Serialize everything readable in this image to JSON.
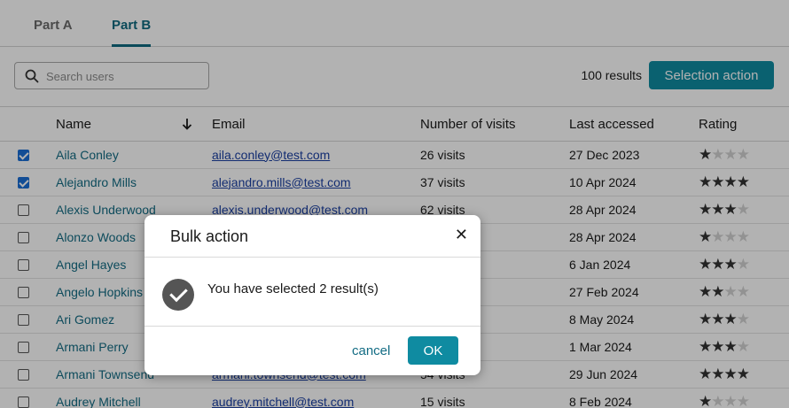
{
  "tabs": [
    {
      "label": "Part A",
      "active": false
    },
    {
      "label": "Part B",
      "active": true
    }
  ],
  "search": {
    "placeholder": "Search users",
    "value": ""
  },
  "results_count": "100 results",
  "selection_action_label": "Selection action",
  "table": {
    "columns": {
      "name": "Name",
      "email": "Email",
      "visits": "Number of visits",
      "last_accessed": "Last accessed",
      "rating": "Rating"
    },
    "sort_icon": "arrow-down-icon",
    "rows": [
      {
        "checked": true,
        "name": "Aila Conley",
        "email": "aila.conley@test.com",
        "visits": "26 visits",
        "last": "27 Dec 2023",
        "rating": 1
      },
      {
        "checked": true,
        "name": "Alejandro Mills",
        "email": "alejandro.mills@test.com",
        "visits": "37 visits",
        "last": "10 Apr 2024",
        "rating": 4
      },
      {
        "checked": false,
        "name": "Alexis Underwood",
        "email": "alexis.underwood@test.com",
        "visits": "62 visits",
        "last": "28 Apr 2024",
        "rating": 3
      },
      {
        "checked": false,
        "name": "Alonzo Woods",
        "email": "",
        "visits": "",
        "last": "28 Apr 2024",
        "rating": 1
      },
      {
        "checked": false,
        "name": "Angel Hayes",
        "email": "",
        "visits": "",
        "last": "6 Jan 2024",
        "rating": 3
      },
      {
        "checked": false,
        "name": "Angelo Hopkins",
        "email": "",
        "visits": "",
        "last": "27 Feb 2024",
        "rating": 2
      },
      {
        "checked": false,
        "name": "Ari Gomez",
        "email": "",
        "visits": "",
        "last": "8 May 2024",
        "rating": 3
      },
      {
        "checked": false,
        "name": "Armani Perry",
        "email": "",
        "visits": "",
        "last": "1 Mar 2024",
        "rating": 3
      },
      {
        "checked": false,
        "name": "Armani Townsend",
        "email": "armani.townsend@test.com",
        "visits": "54 visits",
        "last": "29 Jun 2024",
        "rating": 4
      },
      {
        "checked": false,
        "name": "Audrey Mitchell",
        "email": "audrey.mitchell@test.com",
        "visits": "15 visits",
        "last": "8 Feb 2024",
        "rating": 1
      }
    ]
  },
  "modal": {
    "title": "Bulk action",
    "close_icon": "close-icon",
    "status_icon": "check-circle-icon",
    "message": "You have selected 2 result(s)",
    "cancel_label": "cancel",
    "ok_label": "OK"
  },
  "colors": {
    "accent": "#0f8ba1",
    "link": "#136c84",
    "email_link": "#1a3fa3",
    "checkbox_on": "#1a6fd6"
  }
}
